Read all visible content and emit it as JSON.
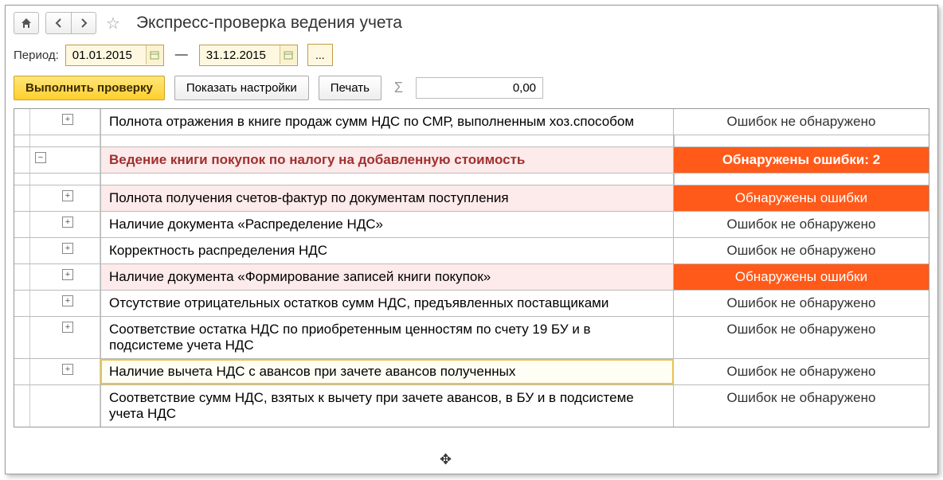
{
  "header": {
    "title": "Экспресс-проверка ведения учета"
  },
  "period": {
    "label": "Период:",
    "from": "01.01.2015",
    "to": "31.12.2015"
  },
  "actions": {
    "run": "Выполнить проверку",
    "settings": "Показать настройки",
    "print": "Печать",
    "amount": "0,00"
  },
  "statuses": {
    "ok": "Ошибок не обнаружено",
    "err": "Обнаружены ошибки",
    "section_err": "Обнаружены ошибки: 2"
  },
  "rows": {
    "pre": "Полнота отражения в книге продаж сумм НДС по СМР, выполненным хоз.способом",
    "section": "Ведение книги покупок по налогу на добавленную стоимость",
    "r1": "Полнота получения счетов-фактур по документам поступления",
    "r2": "Наличие документа «Распределение НДС»",
    "r3": "Корректность распределения НДС",
    "r4": "Наличие документа «Формирование записей книги покупок»",
    "r5": "Отсутствие отрицательных остатков сумм НДС, предъявленных поставщиками",
    "r6": "Соответствие остатка НДС по приобретенным ценностям по счету 19 БУ и в подсистеме учета НДС",
    "r7": "Наличие вычета НДС с авансов при зачете авансов полученных",
    "r8": "Соответствие сумм НДС, взятых к вычету при зачете авансов, в БУ и в подсистеме учета НДС"
  }
}
